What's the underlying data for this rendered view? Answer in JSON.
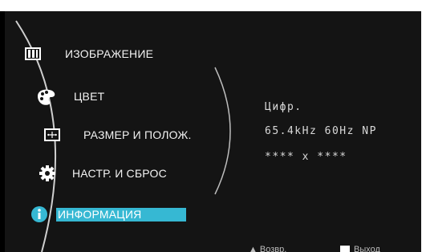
{
  "menu": {
    "items": [
      {
        "label": "ИЗОБРАЖЕНИЕ",
        "icon": "picture-icon"
      },
      {
        "label": "ЦВЕТ",
        "icon": "palette-icon"
      },
      {
        "label": "РАЗМЕР И ПОЛОЖ.",
        "icon": "size-position-icon"
      },
      {
        "label": "НАСТР. И СБРОС",
        "icon": "gear-icon"
      },
      {
        "label": "ИНФОРМАЦИЯ",
        "icon": "info-icon",
        "selected": true
      }
    ]
  },
  "info_panel": {
    "line1": "Цифр.",
    "line2": "65.4kHz 60Hz NP",
    "line3": "**** x ****"
  },
  "footer": {
    "return_label": "Возвр.",
    "exit_label": "Выход"
  },
  "colors": {
    "highlight": "#36b8d3",
    "background": "#141414"
  }
}
